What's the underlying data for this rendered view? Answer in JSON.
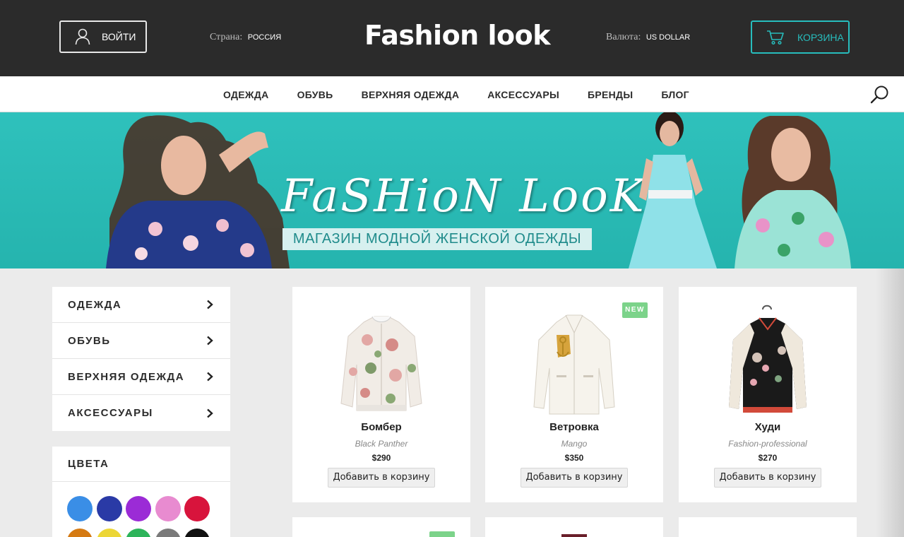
{
  "header": {
    "login_label": "ВОЙТИ",
    "country_label": "Страна:",
    "country_value": "РОССИЯ",
    "logo": "Fashion look",
    "currency_label": "Валюта:",
    "currency_value": "US DOLLAR",
    "cart_label": "КОРЗИНА"
  },
  "nav": {
    "items": [
      {
        "label": "ОДЕЖДА"
      },
      {
        "label": "ОБУВЬ"
      },
      {
        "label": "ВЕРХНЯЯ ОДЕЖДА"
      },
      {
        "label": "АКСЕССУАРЫ"
      },
      {
        "label": "БРЕНДЫ"
      },
      {
        "label": "БЛОГ"
      }
    ]
  },
  "banner": {
    "title": "FaSHioN LooK",
    "subtitle": "МАГАЗИН МОДНОЙ ЖЕНСКОЙ ОДЕЖДЫ"
  },
  "sidebar": {
    "items": [
      {
        "label": "ОДЕЖДА"
      },
      {
        "label": "ОБУВЬ"
      },
      {
        "label": "ВЕРХНЯЯ ОДЕЖДА"
      },
      {
        "label": "АКСЕССУАРЫ"
      }
    ],
    "colors_title": "ЦВЕТА",
    "colors": [
      "#3a8ee6",
      "#2a3aa6",
      "#9b2bd6",
      "#e88bd0",
      "#d8143c",
      "#d57a12",
      "#ecd636",
      "#2db45a",
      "#7a7a7a",
      "#111111"
    ]
  },
  "products": [
    {
      "name": "Бомбер",
      "brand": "Black Panther",
      "price": "$290",
      "add_label": "Добавить в корзину",
      "badge": ""
    },
    {
      "name": "Ветровка",
      "brand": "Mango",
      "price": "$350",
      "add_label": "Добавить в корзину",
      "badge": "NEW"
    },
    {
      "name": "Худи",
      "brand": "Fashion-professional",
      "price": "$270",
      "add_label": "Добавить в корзину",
      "badge": ""
    }
  ],
  "colors": {
    "header_bg": "#2b2b2b",
    "accent": "#27bdbd",
    "banner_bg": "#2fc1bc",
    "badge_new": "#7cd38a"
  }
}
